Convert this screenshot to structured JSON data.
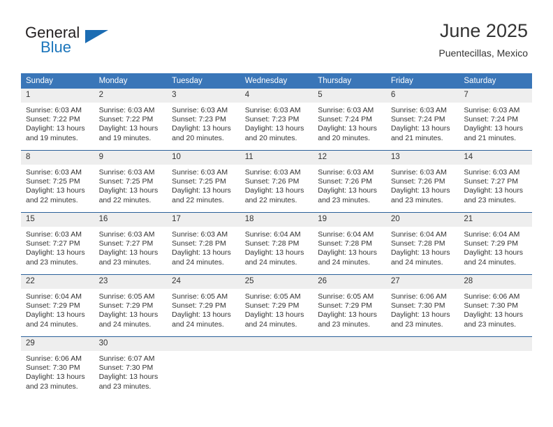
{
  "brand": {
    "name_top": "General",
    "name_bottom": "Blue",
    "flag_icon": "triangle-flag-icon",
    "accent_color": "#1b75bb"
  },
  "header": {
    "title": "June 2025",
    "location": "Puentecillas, Mexico"
  },
  "calendar": {
    "header_bg": "#3a76b8",
    "daynum_bg": "#eeeeee",
    "row_border_color": "#2a6099",
    "weekday_headers": [
      "Sunday",
      "Monday",
      "Tuesday",
      "Wednesday",
      "Thursday",
      "Friday",
      "Saturday"
    ],
    "weeks": [
      [
        {
          "day": "1",
          "sunrise": "Sunrise: 6:03 AM",
          "sunset": "Sunset: 7:22 PM",
          "daylight_1": "Daylight: 13 hours",
          "daylight_2": "and 19 minutes."
        },
        {
          "day": "2",
          "sunrise": "Sunrise: 6:03 AM",
          "sunset": "Sunset: 7:22 PM",
          "daylight_1": "Daylight: 13 hours",
          "daylight_2": "and 19 minutes."
        },
        {
          "day": "3",
          "sunrise": "Sunrise: 6:03 AM",
          "sunset": "Sunset: 7:23 PM",
          "daylight_1": "Daylight: 13 hours",
          "daylight_2": "and 20 minutes."
        },
        {
          "day": "4",
          "sunrise": "Sunrise: 6:03 AM",
          "sunset": "Sunset: 7:23 PM",
          "daylight_1": "Daylight: 13 hours",
          "daylight_2": "and 20 minutes."
        },
        {
          "day": "5",
          "sunrise": "Sunrise: 6:03 AM",
          "sunset": "Sunset: 7:24 PM",
          "daylight_1": "Daylight: 13 hours",
          "daylight_2": "and 20 minutes."
        },
        {
          "day": "6",
          "sunrise": "Sunrise: 6:03 AM",
          "sunset": "Sunset: 7:24 PM",
          "daylight_1": "Daylight: 13 hours",
          "daylight_2": "and 21 minutes."
        },
        {
          "day": "7",
          "sunrise": "Sunrise: 6:03 AM",
          "sunset": "Sunset: 7:24 PM",
          "daylight_1": "Daylight: 13 hours",
          "daylight_2": "and 21 minutes."
        }
      ],
      [
        {
          "day": "8",
          "sunrise": "Sunrise: 6:03 AM",
          "sunset": "Sunset: 7:25 PM",
          "daylight_1": "Daylight: 13 hours",
          "daylight_2": "and 22 minutes."
        },
        {
          "day": "9",
          "sunrise": "Sunrise: 6:03 AM",
          "sunset": "Sunset: 7:25 PM",
          "daylight_1": "Daylight: 13 hours",
          "daylight_2": "and 22 minutes."
        },
        {
          "day": "10",
          "sunrise": "Sunrise: 6:03 AM",
          "sunset": "Sunset: 7:25 PM",
          "daylight_1": "Daylight: 13 hours",
          "daylight_2": "and 22 minutes."
        },
        {
          "day": "11",
          "sunrise": "Sunrise: 6:03 AM",
          "sunset": "Sunset: 7:26 PM",
          "daylight_1": "Daylight: 13 hours",
          "daylight_2": "and 22 minutes."
        },
        {
          "day": "12",
          "sunrise": "Sunrise: 6:03 AM",
          "sunset": "Sunset: 7:26 PM",
          "daylight_1": "Daylight: 13 hours",
          "daylight_2": "and 23 minutes."
        },
        {
          "day": "13",
          "sunrise": "Sunrise: 6:03 AM",
          "sunset": "Sunset: 7:26 PM",
          "daylight_1": "Daylight: 13 hours",
          "daylight_2": "and 23 minutes."
        },
        {
          "day": "14",
          "sunrise": "Sunrise: 6:03 AM",
          "sunset": "Sunset: 7:27 PM",
          "daylight_1": "Daylight: 13 hours",
          "daylight_2": "and 23 minutes."
        }
      ],
      [
        {
          "day": "15",
          "sunrise": "Sunrise: 6:03 AM",
          "sunset": "Sunset: 7:27 PM",
          "daylight_1": "Daylight: 13 hours",
          "daylight_2": "and 23 minutes."
        },
        {
          "day": "16",
          "sunrise": "Sunrise: 6:03 AM",
          "sunset": "Sunset: 7:27 PM",
          "daylight_1": "Daylight: 13 hours",
          "daylight_2": "and 23 minutes."
        },
        {
          "day": "17",
          "sunrise": "Sunrise: 6:03 AM",
          "sunset": "Sunset: 7:28 PM",
          "daylight_1": "Daylight: 13 hours",
          "daylight_2": "and 24 minutes."
        },
        {
          "day": "18",
          "sunrise": "Sunrise: 6:04 AM",
          "sunset": "Sunset: 7:28 PM",
          "daylight_1": "Daylight: 13 hours",
          "daylight_2": "and 24 minutes."
        },
        {
          "day": "19",
          "sunrise": "Sunrise: 6:04 AM",
          "sunset": "Sunset: 7:28 PM",
          "daylight_1": "Daylight: 13 hours",
          "daylight_2": "and 24 minutes."
        },
        {
          "day": "20",
          "sunrise": "Sunrise: 6:04 AM",
          "sunset": "Sunset: 7:28 PM",
          "daylight_1": "Daylight: 13 hours",
          "daylight_2": "and 24 minutes."
        },
        {
          "day": "21",
          "sunrise": "Sunrise: 6:04 AM",
          "sunset": "Sunset: 7:29 PM",
          "daylight_1": "Daylight: 13 hours",
          "daylight_2": "and 24 minutes."
        }
      ],
      [
        {
          "day": "22",
          "sunrise": "Sunrise: 6:04 AM",
          "sunset": "Sunset: 7:29 PM",
          "daylight_1": "Daylight: 13 hours",
          "daylight_2": "and 24 minutes."
        },
        {
          "day": "23",
          "sunrise": "Sunrise: 6:05 AM",
          "sunset": "Sunset: 7:29 PM",
          "daylight_1": "Daylight: 13 hours",
          "daylight_2": "and 24 minutes."
        },
        {
          "day": "24",
          "sunrise": "Sunrise: 6:05 AM",
          "sunset": "Sunset: 7:29 PM",
          "daylight_1": "Daylight: 13 hours",
          "daylight_2": "and 24 minutes."
        },
        {
          "day": "25",
          "sunrise": "Sunrise: 6:05 AM",
          "sunset": "Sunset: 7:29 PM",
          "daylight_1": "Daylight: 13 hours",
          "daylight_2": "and 24 minutes."
        },
        {
          "day": "26",
          "sunrise": "Sunrise: 6:05 AM",
          "sunset": "Sunset: 7:29 PM",
          "daylight_1": "Daylight: 13 hours",
          "daylight_2": "and 23 minutes."
        },
        {
          "day": "27",
          "sunrise": "Sunrise: 6:06 AM",
          "sunset": "Sunset: 7:30 PM",
          "daylight_1": "Daylight: 13 hours",
          "daylight_2": "and 23 minutes."
        },
        {
          "day": "28",
          "sunrise": "Sunrise: 6:06 AM",
          "sunset": "Sunset: 7:30 PM",
          "daylight_1": "Daylight: 13 hours",
          "daylight_2": "and 23 minutes."
        }
      ],
      [
        {
          "day": "29",
          "sunrise": "Sunrise: 6:06 AM",
          "sunset": "Sunset: 7:30 PM",
          "daylight_1": "Daylight: 13 hours",
          "daylight_2": "and 23 minutes."
        },
        {
          "day": "30",
          "sunrise": "Sunrise: 6:07 AM",
          "sunset": "Sunset: 7:30 PM",
          "daylight_1": "Daylight: 13 hours",
          "daylight_2": "and 23 minutes."
        },
        {
          "day": "",
          "sunrise": "",
          "sunset": "",
          "daylight_1": "",
          "daylight_2": ""
        },
        {
          "day": "",
          "sunrise": "",
          "sunset": "",
          "daylight_1": "",
          "daylight_2": ""
        },
        {
          "day": "",
          "sunrise": "",
          "sunset": "",
          "daylight_1": "",
          "daylight_2": ""
        },
        {
          "day": "",
          "sunrise": "",
          "sunset": "",
          "daylight_1": "",
          "daylight_2": ""
        },
        {
          "day": "",
          "sunrise": "",
          "sunset": "",
          "daylight_1": "",
          "daylight_2": ""
        }
      ]
    ]
  }
}
